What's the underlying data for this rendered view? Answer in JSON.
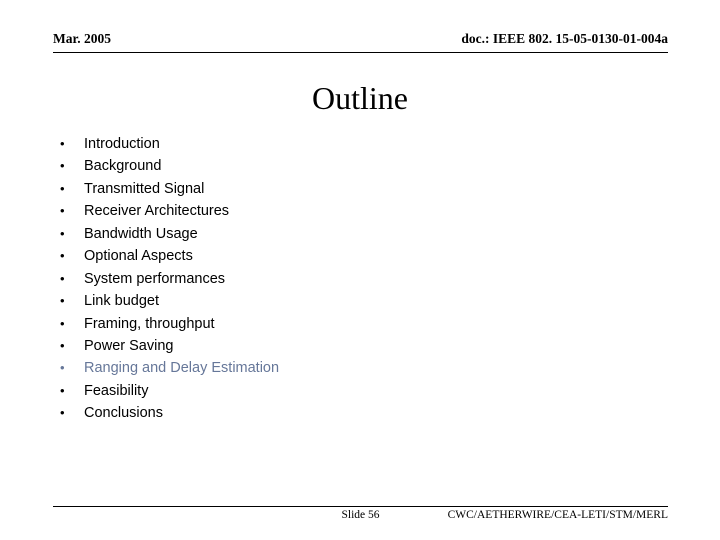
{
  "slide": {
    "background_color": "#ffffff",
    "accent_color": "#667799",
    "text_color": "#000000"
  },
  "header": {
    "date": "Mar. 2005",
    "doc_id": "doc.: IEEE 802. 15-05-0130-01-004a"
  },
  "title": "Outline",
  "bullets": [
    {
      "marker": "•",
      "label": "Introduction",
      "highlighted": false
    },
    {
      "marker": "•",
      "label": "Background",
      "highlighted": false
    },
    {
      "marker": "•",
      "label": "Transmitted Signal",
      "highlighted": false
    },
    {
      "marker": "•",
      "label": "Receiver Architectures",
      "highlighted": false
    },
    {
      "marker": "•",
      "label": "Bandwidth Usage",
      "highlighted": false
    },
    {
      "marker": "•",
      "label": "Optional Aspects",
      "highlighted": false
    },
    {
      "marker": "•",
      "label": "System performances",
      "highlighted": false
    },
    {
      "marker": "•",
      "label": "Link budget",
      "highlighted": false
    },
    {
      "marker": "•",
      "label": "Framing, throughput",
      "highlighted": false
    },
    {
      "marker": "•",
      "label": "Power Saving",
      "highlighted": false
    },
    {
      "marker": "•",
      "label": "Ranging and Delay Estimation",
      "highlighted": true
    },
    {
      "marker": "•",
      "label": "Feasibility",
      "highlighted": false
    },
    {
      "marker": "•",
      "label": "Conclusions",
      "highlighted": false
    }
  ],
  "footer": {
    "slide_number": "Slide 56",
    "organizations": "CWC/AETHERWIRE/CEA-LETI/STM/MERL"
  }
}
